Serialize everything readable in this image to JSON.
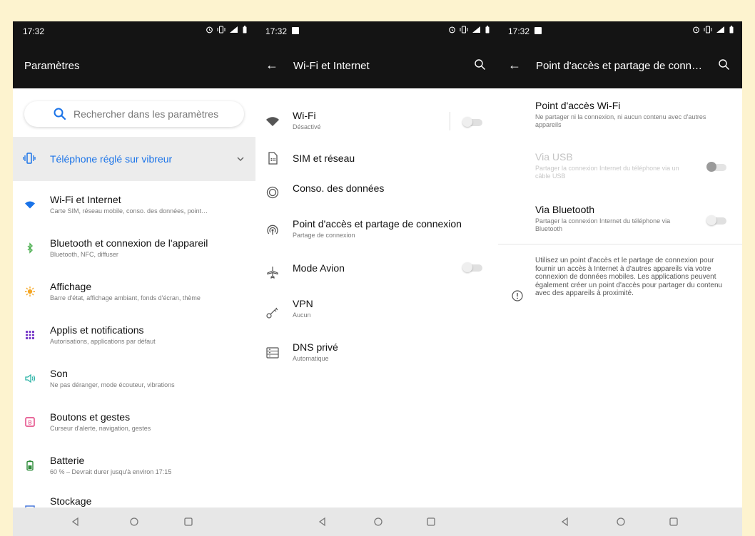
{
  "screens": {
    "s1": {
      "time": "17:32",
      "title": "Paramètres",
      "search_placeholder": "Rechercher dans les paramètres",
      "vibrate_label": "Téléphone réglé sur vibreur",
      "items": [
        {
          "title": "Wi-Fi et Internet",
          "subtitle": "Carte SIM, réseau mobile, conso. des données, point…",
          "icon": "wifi-icon",
          "color": "#1a73e8"
        },
        {
          "title": "Bluetooth et connexion de l'appareil",
          "subtitle": "Bluetooth, NFC, diffuser",
          "icon": "bluetooth-icon",
          "color": "#4caf50"
        },
        {
          "title": "Affichage",
          "subtitle": "Barre d'état, affichage ambiant, fonds d'écran, thème",
          "icon": "brightness-icon",
          "color": "#f5a623"
        },
        {
          "title": "Applis et notifications",
          "subtitle": "Autorisations, applications par défaut",
          "icon": "apps-grid-icon",
          "color": "#7b3fc9"
        },
        {
          "title": "Son",
          "subtitle": "Ne pas déranger, mode écouteur, vibrations",
          "icon": "speaker-icon",
          "color": "#2bb3a6"
        },
        {
          "title": "Boutons et gestes",
          "subtitle": "Curseur d'alerte, navigation, gestes",
          "icon": "buttons-gestures-icon",
          "color": "#e0387a"
        },
        {
          "title": "Batterie",
          "subtitle": "60 % – Devrait durer jusqu'à environ 17:15",
          "icon": "battery-icon",
          "color": "#2e8b3a"
        },
        {
          "title": "Stockage",
          "subtitle": "",
          "icon": "storage-icon",
          "color": "#3b6ed8"
        }
      ]
    },
    "s2": {
      "time": "17:32",
      "title": "Wi-Fi et Internet",
      "items": [
        {
          "title": "Wi-Fi",
          "subtitle": "Désactivé",
          "icon": "wifi-icon",
          "toggle": "off"
        },
        {
          "title": "SIM et réseau",
          "subtitle": "",
          "icon": "sim-card-icon"
        },
        {
          "title": "Conso. des données",
          "subtitle": "",
          "icon": "data-usage-icon"
        },
        {
          "title": "Point d'accès et partage de connexion",
          "subtitle": "Partage de connexion",
          "icon": "hotspot-icon"
        },
        {
          "title": "Mode Avion",
          "subtitle": "",
          "icon": "airplane-icon",
          "toggle": "off"
        },
        {
          "title": "VPN",
          "subtitle": "Aucun",
          "icon": "vpn-key-icon"
        },
        {
          "title": "DNS privé",
          "subtitle": "Automatique",
          "icon": "dns-icon"
        }
      ]
    },
    "s3": {
      "time": "17:32",
      "title": "Point d'accès et partage de connexion",
      "items": [
        {
          "title": "Point d'accès Wi-Fi",
          "subtitle": "Ne partager ni la connexion, ni aucun contenu avec d'autres appareils"
        },
        {
          "title": "Via USB",
          "subtitle": "Partager la connexion Internet du téléphone via un câble USB",
          "disabled": true,
          "toggle": "off"
        },
        {
          "title": "Via Bluetooth",
          "subtitle": "Partager la connexion Internet du téléphone via Bluetooth",
          "toggle": "off"
        }
      ],
      "info": "Utilisez un point d'accès et le partage de connexion pour fournir un accès à Internet à d'autres appareils via votre connexion de données mobiles. Les applications peuvent également créer un point d'accès pour partager du contenu avec des appareils à proximité."
    }
  },
  "colors": {
    "background": "#fdf3cf",
    "statusbar": "#141414",
    "accent": "#1a73e8",
    "navbar": "#e7e7e7"
  }
}
